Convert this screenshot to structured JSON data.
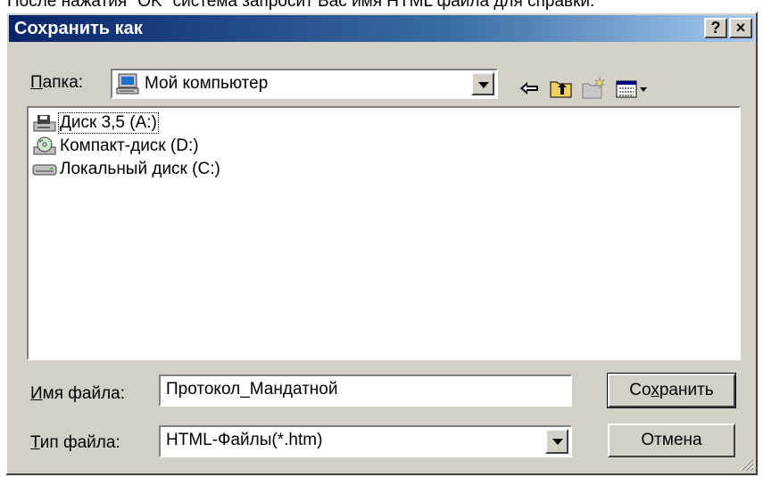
{
  "page_caption": "После нажатия \"OK\" система запросит Вас имя HTML файла для справки.",
  "dialog": {
    "title": "Сохранить как",
    "help_button": "?",
    "close_button": "×"
  },
  "location": {
    "label": "Папка:",
    "label_mnemonic": "П",
    "label_rest": "апка:",
    "value": "Мой компьютер"
  },
  "toolbar": {
    "icons": [
      "back-arrow-icon",
      "up-folder-icon",
      "new-folder-icon",
      "view-menu-icon"
    ]
  },
  "file_list": [
    {
      "name": "Диск 3,5 (A:)",
      "icon": "floppy-drive-icon",
      "focused": true
    },
    {
      "name": "Компакт-диск (D:)",
      "icon": "cd-drive-icon",
      "focused": false
    },
    {
      "name": "Локальный диск (C:)",
      "icon": "hard-drive-icon",
      "focused": false
    }
  ],
  "filename": {
    "label_mnemonic": "И",
    "label_rest": "мя файла:",
    "value": "Протокол_Мандатной"
  },
  "filetype": {
    "label_mnemonic": "Т",
    "label_rest": "ип файла:",
    "value": "HTML-Файлы(*.htm)"
  },
  "buttons": {
    "save_pre": "Со",
    "save_mnemonic": "х",
    "save_post": "ранить",
    "cancel": "Отмена"
  },
  "colors": {
    "face": "#d4d0c8",
    "title_start": "#0a246a",
    "title_end": "#a6caf0"
  }
}
